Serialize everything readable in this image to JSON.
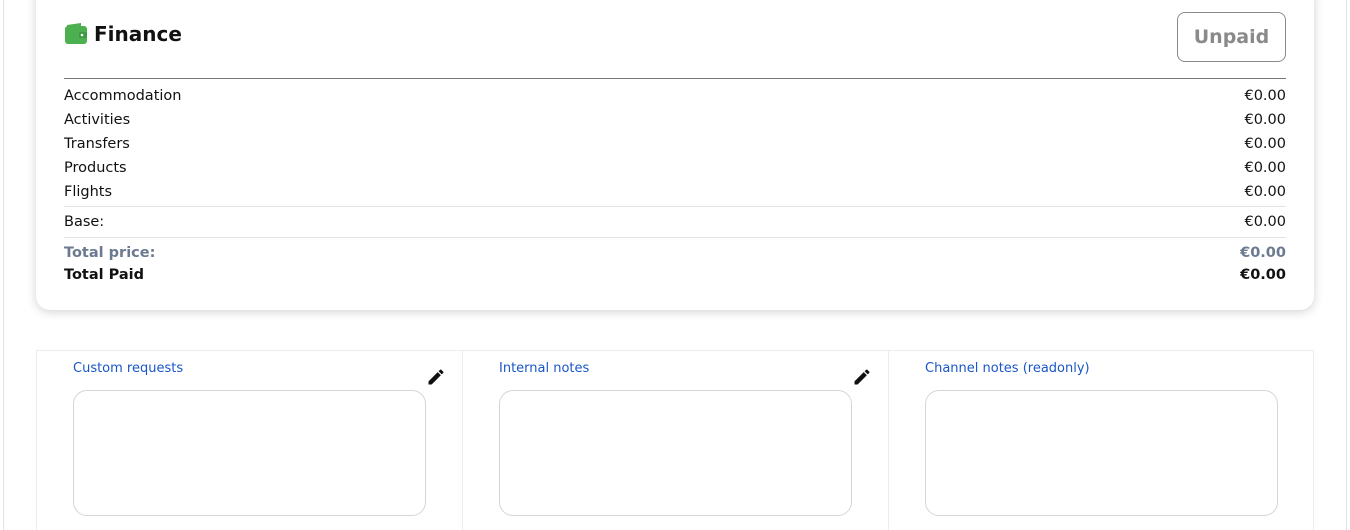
{
  "finance": {
    "title": "Finance",
    "icon": "wallet-icon",
    "accent_color": "#4caf50",
    "status_label": "Unpaid",
    "items": [
      {
        "label": "Accommodation",
        "amount": "€0.00"
      },
      {
        "label": "Activities",
        "amount": "€0.00"
      },
      {
        "label": "Transfers",
        "amount": "€0.00"
      },
      {
        "label": "Products",
        "amount": "€0.00"
      },
      {
        "label": "Flights",
        "amount": "€0.00"
      }
    ],
    "base": {
      "label": "Base:",
      "amount": "€0.00"
    },
    "total_price": {
      "label": "Total price:",
      "amount": "€0.00"
    },
    "total_paid": {
      "label": "Total Paid",
      "amount": "€0.00"
    }
  },
  "notes": {
    "custom_requests": {
      "label": "Custom requests",
      "value": ""
    },
    "internal_notes": {
      "label": "Internal notes",
      "value": ""
    },
    "channel_notes": {
      "label": "Channel notes (readonly)",
      "value": ""
    }
  }
}
